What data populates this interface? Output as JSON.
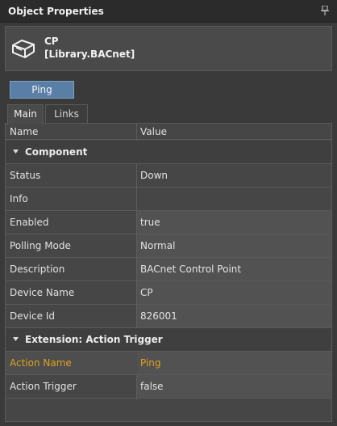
{
  "panel": {
    "title": "Object Properties"
  },
  "object": {
    "name": "CP",
    "library": "[Library.BACnet]",
    "icon": "cube-icon"
  },
  "actions": {
    "ping_label": "Ping"
  },
  "tabs": [
    {
      "label": "Main",
      "active": true
    },
    {
      "label": "Links",
      "active": false
    }
  ],
  "grid": {
    "columns": {
      "name": "Name",
      "value": "Value"
    },
    "categories": [
      {
        "label": "Component",
        "rows": [
          {
            "name": "Status",
            "value": "Down"
          },
          {
            "name": "Info",
            "value": ""
          },
          {
            "name": "Enabled",
            "value": "true"
          },
          {
            "name": "Polling Mode",
            "value": "Normal"
          },
          {
            "name": "Description",
            "value": "BACnet Control Point"
          },
          {
            "name": "Device Name",
            "value": "CP"
          },
          {
            "name": "Device Id",
            "value": "826001"
          }
        ]
      },
      {
        "label": "Extension: Action Trigger",
        "rows": [
          {
            "name": "Action Name",
            "value": "Ping",
            "selected": true
          },
          {
            "name": "Action Trigger",
            "value": "false"
          }
        ]
      }
    ]
  },
  "colors": {
    "background": "#3a3a3a",
    "accent_button": "#5a7fa6",
    "selected_text": "#e0a11f"
  }
}
